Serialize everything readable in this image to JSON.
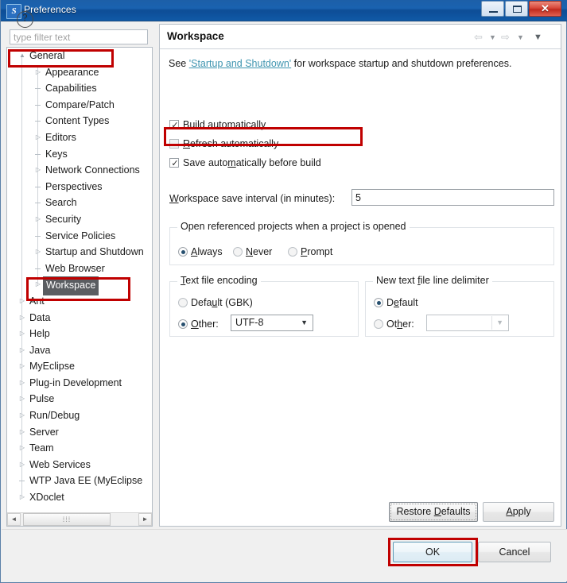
{
  "window": {
    "title": "Preferences",
    "icon": "eclipse-icon",
    "buttons": {
      "minimize": "minimize-icon",
      "maximize": "restore-icon",
      "close": "✕"
    }
  },
  "sidebar": {
    "filter": {
      "placeholder": "type filter text",
      "value": ""
    },
    "scrollbar": {
      "left_arrow": "◄",
      "right_arrow": "►",
      "thumb_grip": "⁞⁞⁞"
    },
    "items": [
      {
        "label": "General",
        "depth": 0,
        "expanded": true,
        "selected": false,
        "twisty": "▲"
      },
      {
        "label": "Appearance",
        "depth": 1,
        "expanded": false,
        "selected": false,
        "twisty": "▷"
      },
      {
        "label": "Capabilities",
        "depth": 1,
        "expanded": null,
        "selected": false,
        "twisty": ""
      },
      {
        "label": "Compare/Patch",
        "depth": 1,
        "expanded": null,
        "selected": false,
        "twisty": ""
      },
      {
        "label": "Content Types",
        "depth": 1,
        "expanded": null,
        "selected": false,
        "twisty": ""
      },
      {
        "label": "Editors",
        "depth": 1,
        "expanded": false,
        "selected": false,
        "twisty": "▷"
      },
      {
        "label": "Keys",
        "depth": 1,
        "expanded": null,
        "selected": false,
        "twisty": ""
      },
      {
        "label": "Network Connections",
        "depth": 1,
        "expanded": false,
        "selected": false,
        "twisty": "▷"
      },
      {
        "label": "Perspectives",
        "depth": 1,
        "expanded": null,
        "selected": false,
        "twisty": ""
      },
      {
        "label": "Search",
        "depth": 1,
        "expanded": null,
        "selected": false,
        "twisty": ""
      },
      {
        "label": "Security",
        "depth": 1,
        "expanded": false,
        "selected": false,
        "twisty": "▷"
      },
      {
        "label": "Service Policies",
        "depth": 1,
        "expanded": null,
        "selected": false,
        "twisty": ""
      },
      {
        "label": "Startup and Shutdown",
        "depth": 1,
        "expanded": false,
        "selected": false,
        "twisty": "▷"
      },
      {
        "label": "Web Browser",
        "depth": 1,
        "expanded": null,
        "selected": false,
        "twisty": ""
      },
      {
        "label": "Workspace",
        "depth": 1,
        "expanded": false,
        "selected": true,
        "twisty": "▷"
      },
      {
        "label": "Ant",
        "depth": 0,
        "expanded": false,
        "selected": false,
        "twisty": "▷"
      },
      {
        "label": "Data",
        "depth": 0,
        "expanded": false,
        "selected": false,
        "twisty": "▷"
      },
      {
        "label": "Help",
        "depth": 0,
        "expanded": false,
        "selected": false,
        "twisty": "▷"
      },
      {
        "label": "Java",
        "depth": 0,
        "expanded": false,
        "selected": false,
        "twisty": "▷"
      },
      {
        "label": "MyEclipse",
        "depth": 0,
        "expanded": false,
        "selected": false,
        "twisty": "▷"
      },
      {
        "label": "Plug-in Development",
        "depth": 0,
        "expanded": false,
        "selected": false,
        "twisty": "▷"
      },
      {
        "label": "Pulse",
        "depth": 0,
        "expanded": false,
        "selected": false,
        "twisty": "▷"
      },
      {
        "label": "Run/Debug",
        "depth": 0,
        "expanded": false,
        "selected": false,
        "twisty": "▷"
      },
      {
        "label": "Server",
        "depth": 0,
        "expanded": false,
        "selected": false,
        "twisty": "▷"
      },
      {
        "label": "Team",
        "depth": 0,
        "expanded": false,
        "selected": false,
        "twisty": "▷"
      },
      {
        "label": "Web Services",
        "depth": 0,
        "expanded": false,
        "selected": false,
        "twisty": "▷"
      },
      {
        "label": "WTP Java EE (MyEclipse",
        "depth": 0,
        "expanded": null,
        "selected": false,
        "twisty": ""
      },
      {
        "label": "XDoclet",
        "depth": 0,
        "expanded": false,
        "selected": false,
        "twisty": "▷"
      }
    ]
  },
  "panel": {
    "title": "Workspace",
    "nav": {
      "back": "⇦",
      "back_dropdown": "▼",
      "forward": "⇨",
      "forward_dropdown": "▼",
      "menu": "▼"
    },
    "description": {
      "prefix": "See ",
      "link": "'Startup and Shutdown'",
      "suffix": " for workspace startup and shutdown preferences."
    },
    "checkboxes": [
      {
        "label_pre": "",
        "mnemonic": "B",
        "label_post": "uild automatically",
        "checked": true
      },
      {
        "label_pre": "",
        "mnemonic": "R",
        "label_post": "efresh automatically",
        "checked": false
      },
      {
        "label_pre": "Save auto",
        "mnemonic": "m",
        "label_post": "atically before build",
        "checked": true
      }
    ],
    "save_interval": {
      "label_pre": "",
      "mnemonic": "W",
      "label_post": "orkspace save interval (in minutes):",
      "value": "5"
    },
    "referenced_projects": {
      "legend": "Open referenced projects when a project is opened",
      "options": [
        {
          "label_pre": "",
          "mnemonic": "A",
          "label_post": "lways",
          "selected": true
        },
        {
          "label_pre": "",
          "mnemonic": "N",
          "label_post": "ever",
          "selected": false
        },
        {
          "label_pre": "",
          "mnemonic": "P",
          "label_post": "rompt",
          "selected": false
        }
      ]
    },
    "text_file_encoding": {
      "legend_pre": "",
      "legend_mnemonic": "T",
      "legend_post": "ext file encoding",
      "options": [
        {
          "label_pre": "Defa",
          "mnemonic": "u",
          "label_post": "lt (GBK)",
          "selected": false
        },
        {
          "label_pre": "",
          "mnemonic": "O",
          "label_post": "ther:",
          "selected": true
        }
      ],
      "combo_value": "UTF-8",
      "combo_arrow": "▼",
      "combo_enabled": true
    },
    "line_delimiter": {
      "legend_pre": "New text ",
      "legend_mnemonic": "f",
      "legend_post": "ile line delimiter",
      "options": [
        {
          "label_pre": "D",
          "mnemonic": "e",
          "label_post": "fault",
          "selected": true
        },
        {
          "label_pre": "Ot",
          "mnemonic": "h",
          "label_post": "er:",
          "selected": false
        }
      ],
      "combo_value": "",
      "combo_arrow": "▼",
      "combo_enabled": false
    },
    "buttons": {
      "restore_pre": "Restore ",
      "restore_mnemonic": "D",
      "restore_post": "efaults",
      "apply_pre": "",
      "apply_mnemonic": "A",
      "apply_post": "pply"
    }
  },
  "footer": {
    "help_icon": "?",
    "ok": "OK",
    "cancel": "Cancel"
  },
  "colors": {
    "titlebar": "#1a62b0",
    "annotation": "#c00000",
    "link": "#3f95b0",
    "selection": "#5a5d61",
    "default_button_border": "#5f9cb8"
  }
}
